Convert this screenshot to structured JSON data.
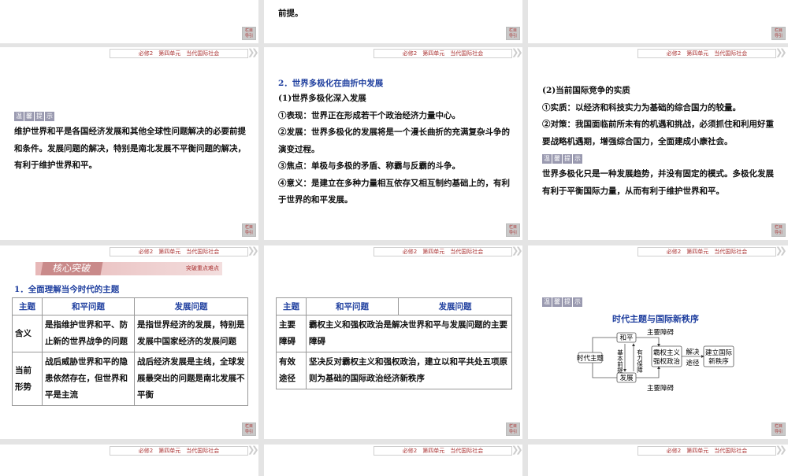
{
  "header": "必修2　第四单元　当代国际社会",
  "nav_label": [
    "栏目",
    "导引"
  ],
  "tip_chars": [
    "温",
    "馨",
    "提",
    "示"
  ],
  "top_slides": {
    "middle_tail": "前提。"
  },
  "slide_r2c1": {
    "text": "维护世界和平是各国经济发展和其他全球性问题解决的必要前提和条件。发展问题的解决，特别是南北发展不平衡问题的解决，有利于维护世界和平。"
  },
  "slide_r2c2": {
    "heading": "2．世界多极化在曲折中发展",
    "sub": "(1)世界多极化深入发展",
    "lines": [
      "①表现：世界正在形成若干个政治经济力量中心。",
      "②发展：世界多极化的发展将是一个漫长曲折的充满复杂斗争的演变过程。",
      "③焦点：单极与多极的矛盾、称霸与反霸的斗争。",
      "④意义：是建立在多种力量相互依存又相互制约基础上的，有利于世界的和平发展。"
    ]
  },
  "slide_r2c3": {
    "sub": "(2)当前国际竞争的实质",
    "lines": [
      "①实质：以经济和科技实力为基础的综合国力的较量。",
      "②对策：我国面临前所未有的机遇和挑战，必须抓住和利用好重要战略机遇期，增强综合国力，全面建成小康社会。"
    ],
    "tip_text": "世界多极化只是一种发展趋势，并没有固定的模式。多极化发展有利于平衡国际力量，从而有利于维护世界和平。"
  },
  "slide_r3c1": {
    "band_title": "核心突破",
    "band_sub": "突破重点难点",
    "heading": "1．全面理解当今时代的主题",
    "table": {
      "headers": [
        "主题",
        "和平问题",
        "发展问题"
      ],
      "rows": [
        [
          "含义",
          "是指维护世界和平、防止新的世界战争的问题",
          "是指世界经济的发展，特别是发展中国家经济的发展问题"
        ],
        [
          "当前形势",
          "战后威胁世界和平的隐患依然存在，但世界和平是主流",
          "战后经济发展是主线，全球发展最突出的问题是南北发展不平衡"
        ]
      ]
    }
  },
  "slide_r3c2": {
    "table": {
      "headers": [
        "主题",
        "和平问题",
        "发展问题"
      ],
      "rows": [
        [
          "主要障碍",
          "霸权主义和强权政治是解决世界和平与发展问题的主要障碍"
        ],
        [
          "有效途径",
          "坚决反对霸权主义和强权政治，建立以和平共处五项原则为基础的国际政治经济新秩序"
        ]
      ]
    }
  },
  "slide_r3c3": {
    "diagram": {
      "title": "时代主题与国际新秩序",
      "root": "时代主题",
      "peace": "和平",
      "dev": "发展",
      "premise": "基本前提",
      "guarantee": "有力保障",
      "obstacle": "主要障碍",
      "hegemony": [
        "霸权主义",
        "强权政治"
      ],
      "way": [
        "解决",
        "途径"
      ],
      "goal": [
        "建立国际",
        "新秩序"
      ]
    }
  }
}
